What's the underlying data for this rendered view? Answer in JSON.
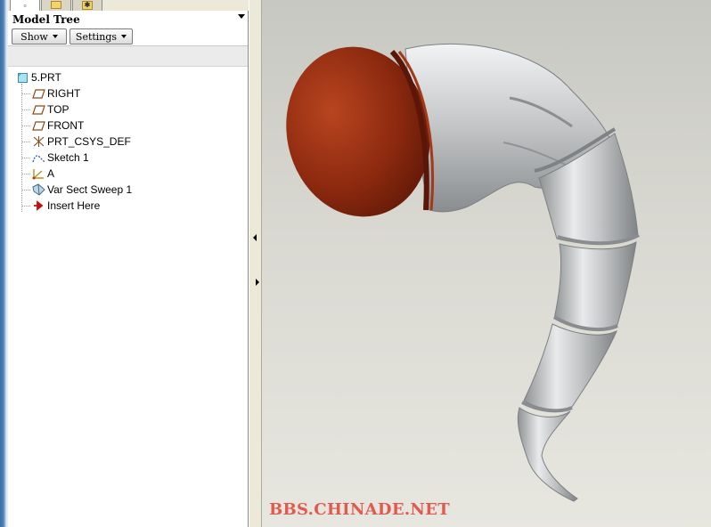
{
  "tabs": [
    {
      "icon": "model-tree-tab-icon",
      "active": true
    },
    {
      "icon": "folder-icon",
      "active": false
    },
    {
      "icon": "favorites-icon",
      "active": false
    }
  ],
  "model_tree": {
    "title": "Model Tree",
    "show_label": "Show",
    "settings_label": "Settings",
    "root": {
      "label": "5.PRT",
      "icon": "part-icon"
    },
    "items": [
      {
        "label": "RIGHT",
        "icon": "datum-plane-icon"
      },
      {
        "label": "TOP",
        "icon": "datum-plane-icon"
      },
      {
        "label": "FRONT",
        "icon": "datum-plane-icon"
      },
      {
        "label": "PRT_CSYS_DEF",
        "icon": "coordinate-system-icon"
      },
      {
        "label": "Sketch 1",
        "icon": "sketch-icon"
      },
      {
        "label": "A",
        "icon": "coordinate-system-icon"
      },
      {
        "label": "Var Sect Sweep 1",
        "icon": "sweep-icon"
      },
      {
        "label": "Insert Here",
        "icon": "insert-here-arrow-icon"
      }
    ]
  },
  "viewport": {
    "watermark": "BBS.CHINADE.NET",
    "colors": {
      "cap": "#8e2a10",
      "body": "#b9bbbd",
      "background": "#d9d9d2"
    }
  }
}
